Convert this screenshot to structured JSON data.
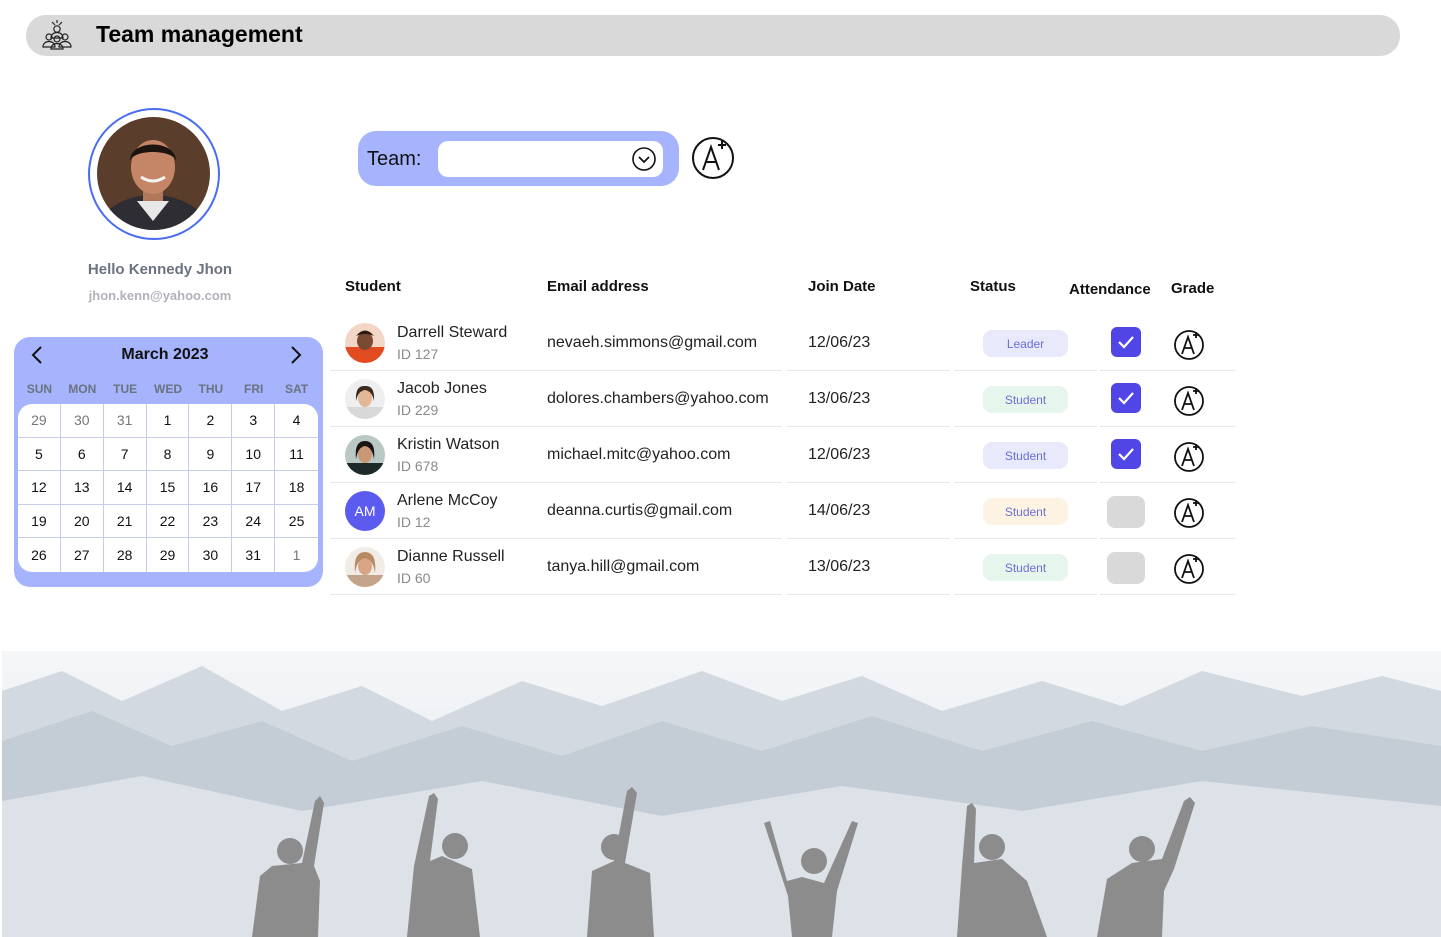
{
  "header": {
    "title": "Team management",
    "logo_icon": "team-icon"
  },
  "profile": {
    "greeting": "Hello Kennedy Jhon",
    "email": "jhon.kenn@yahoo.com",
    "ring_color": "#4a6cf0"
  },
  "calendar": {
    "title": "March 2023",
    "dows": [
      "SUN",
      "MON",
      "TUE",
      "WED",
      "THU",
      "FRI",
      "SAT"
    ],
    "days": [
      {
        "d": "29",
        "m": true
      },
      {
        "d": "30",
        "m": true
      },
      {
        "d": "31",
        "m": true
      },
      {
        "d": "1"
      },
      {
        "d": "2"
      },
      {
        "d": "3"
      },
      {
        "d": "4"
      },
      {
        "d": "5"
      },
      {
        "d": "6"
      },
      {
        "d": "7"
      },
      {
        "d": "8"
      },
      {
        "d": "9"
      },
      {
        "d": "10"
      },
      {
        "d": "11"
      },
      {
        "d": "12"
      },
      {
        "d": "13"
      },
      {
        "d": "14"
      },
      {
        "d": "15"
      },
      {
        "d": "16"
      },
      {
        "d": "17"
      },
      {
        "d": "18"
      },
      {
        "d": "19"
      },
      {
        "d": "20"
      },
      {
        "d": "21"
      },
      {
        "d": "22"
      },
      {
        "d": "23"
      },
      {
        "d": "24"
      },
      {
        "d": "25"
      },
      {
        "d": "26"
      },
      {
        "d": "27"
      },
      {
        "d": "28"
      },
      {
        "d": "29"
      },
      {
        "d": "30"
      },
      {
        "d": "31"
      },
      {
        "d": "1",
        "m": true
      }
    ],
    "accent": "#a5b4fc"
  },
  "team_filter": {
    "label": "Team:",
    "value": ""
  },
  "table": {
    "headers": {
      "student": "Student",
      "email": "Email address",
      "join_date": "Join Date",
      "status": "Status",
      "attendance": "Attendance",
      "grade": "Grade"
    },
    "rows": [
      {
        "name": "Darrell Steward",
        "id": "ID 127",
        "email": "nevaeh.simmons@gmail.com",
        "date": "12/06/23",
        "status": "Leader",
        "status_bg": "#e8e9fb",
        "status_fg": "#6b6fd6",
        "attendance": true,
        "avatar": "photo-1"
      },
      {
        "name": "Jacob Jones",
        "id": "ID 229",
        "email": "dolores.chambers@yahoo.com",
        "date": "13/06/23",
        "status": "Student",
        "status_bg": "#e6f6ec",
        "status_fg": "#6b6fd6",
        "attendance": true,
        "avatar": "photo-2"
      },
      {
        "name": "Kristin Watson",
        "id": "ID 678",
        "email": "michael.mitc@yahoo.com",
        "date": "12/06/23",
        "status": "Student",
        "status_bg": "#e8e9fb",
        "status_fg": "#6b6fd6",
        "attendance": true,
        "avatar": "photo-3"
      },
      {
        "name": "Arlene McCoy",
        "id": "ID 12",
        "email": "deanna.curtis@gmail.com",
        "date": "14/06/23",
        "status": "Student",
        "status_bg": "#fdf3e3",
        "status_fg": "#6b6fd6",
        "attendance": false,
        "avatar": "initials",
        "initials": "AM"
      },
      {
        "name": "Dianne Russell",
        "id": "ID 60",
        "email": "tanya.hill@gmail.com",
        "date": "13/06/23",
        "status": "Student",
        "status_bg": "#e6f6ec",
        "status_fg": "#6b6fd6",
        "attendance": false,
        "avatar": "photo-4"
      }
    ],
    "check_color": "#4f46e5"
  }
}
